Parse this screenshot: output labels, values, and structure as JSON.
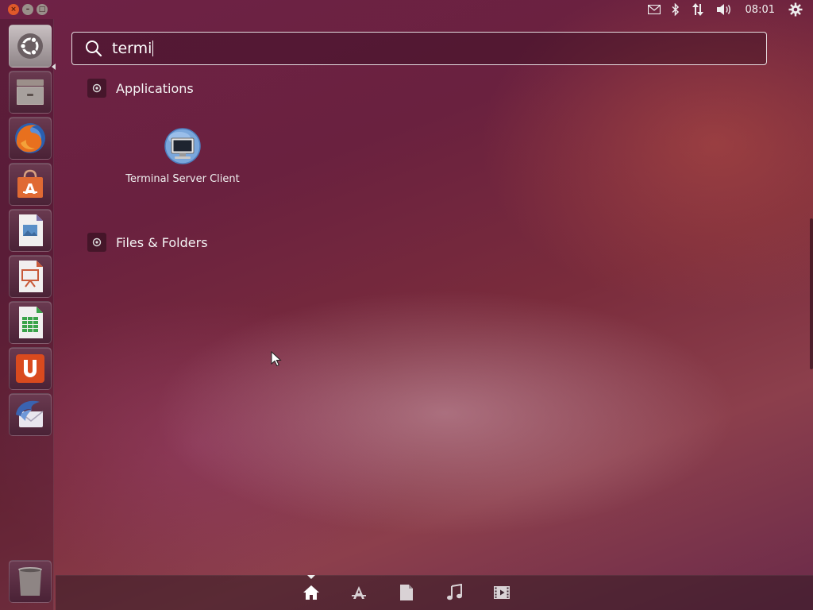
{
  "top_panel": {
    "window_controls": [
      {
        "name": "close",
        "glyph": "×"
      },
      {
        "name": "minimize",
        "glyph": "–"
      },
      {
        "name": "maximize",
        "glyph": "□"
      }
    ],
    "indicators": [
      "mail-icon",
      "bluetooth-icon",
      "network-icon",
      "volume-icon"
    ],
    "clock": "08:01",
    "session_icon": "gear-icon"
  },
  "launcher": {
    "items": [
      {
        "name": "dash-home",
        "icon": "ubuntu-logo-icon"
      },
      {
        "name": "files",
        "icon": "file-cabinet-icon"
      },
      {
        "name": "firefox",
        "icon": "firefox-icon"
      },
      {
        "name": "software-center",
        "icon": "shopping-bag-icon"
      },
      {
        "name": "libreoffice-draw",
        "icon": "document-image-icon"
      },
      {
        "name": "libreoffice-impress",
        "icon": "presentation-icon"
      },
      {
        "name": "libreoffice-calc",
        "icon": "spreadsheet-icon"
      },
      {
        "name": "ubuntu-one",
        "icon": "ubuntu-one-icon"
      },
      {
        "name": "thunderbird",
        "icon": "thunderbird-icon"
      },
      {
        "name": "trash",
        "icon": "trash-icon"
      }
    ]
  },
  "dash": {
    "search": {
      "value": "termi",
      "placeholder": ""
    },
    "categories": [
      {
        "label": "Applications"
      },
      {
        "label": "Files & Folders"
      }
    ],
    "results": [
      {
        "label": "Terminal Server Client",
        "icon": "remote-desktop-icon"
      }
    ]
  },
  "lens_bar": {
    "lenses": [
      {
        "name": "home",
        "icon": "home-icon",
        "active": true
      },
      {
        "name": "applications",
        "icon": "applications-icon",
        "active": false
      },
      {
        "name": "files",
        "icon": "file-icon",
        "active": false
      },
      {
        "name": "music",
        "icon": "music-note-icon",
        "active": false
      },
      {
        "name": "video",
        "icon": "film-icon",
        "active": false
      }
    ]
  },
  "colors": {
    "accent_orange": "#e0592a",
    "panel_text": "#f2f2f2"
  }
}
